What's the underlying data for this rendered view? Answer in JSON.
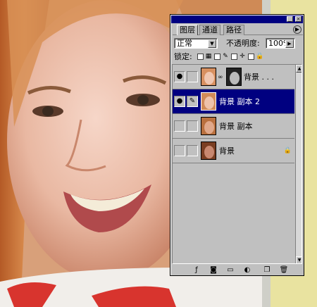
{
  "palette": {
    "tabs": [
      {
        "label": "图层",
        "active": true
      },
      {
        "label": "通道",
        "active": false
      },
      {
        "label": "路径",
        "active": false
      }
    ],
    "blend_mode": "正常",
    "opacity_label": "不透明度:",
    "opacity_value": "100%",
    "lock_label": "锁定:",
    "layers": [
      {
        "name": "背景 . . .",
        "visible": true,
        "selected": false,
        "has_mask": true,
        "locked": false
      },
      {
        "name": "背景 副本 2",
        "visible": true,
        "selected": true,
        "has_mask": false,
        "locked": false
      },
      {
        "name": "背景 副本",
        "visible": false,
        "selected": false,
        "has_mask": false,
        "locked": false
      },
      {
        "name": "背景",
        "visible": false,
        "selected": false,
        "has_mask": false,
        "locked": true
      }
    ],
    "bottom_icons": [
      "layer-style-icon",
      "add-mask-icon",
      "new-set-icon",
      "adjustment-layer-icon",
      "new-layer-icon",
      "trash-icon"
    ]
  }
}
